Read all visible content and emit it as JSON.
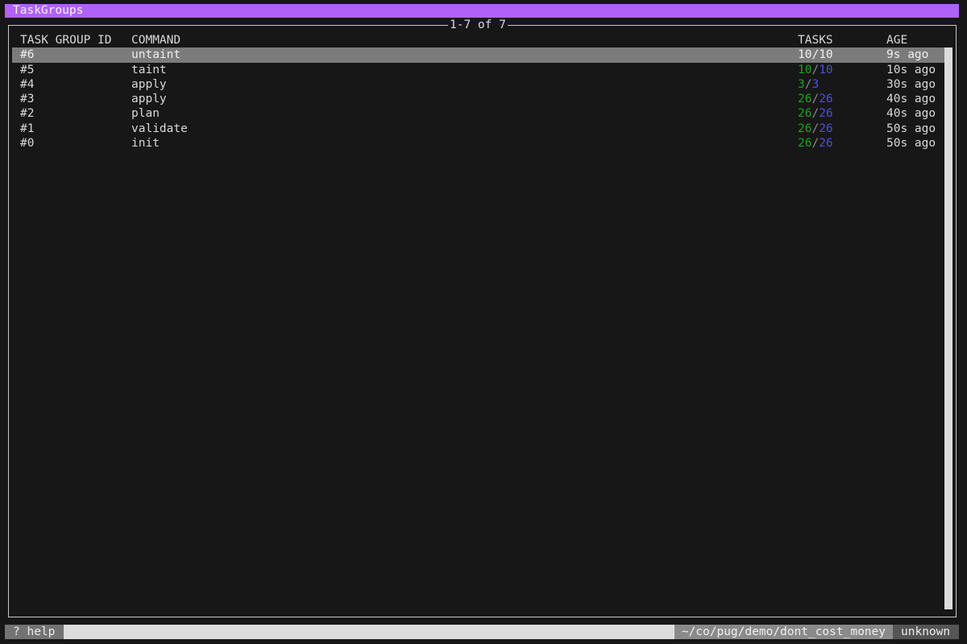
{
  "window": {
    "title": "TaskGroups"
  },
  "pager": {
    "label": "1-7 of 7"
  },
  "table": {
    "columns": {
      "id": "TASK GROUP ID",
      "command": "COMMAND",
      "tasks": "TASKS",
      "age": "AGE"
    },
    "rows": [
      {
        "id": "#6",
        "command": "untaint",
        "tasks_done": "10",
        "tasks_total": "10",
        "age": "9s ago",
        "selected": true
      },
      {
        "id": "#5",
        "command": "taint",
        "tasks_done": "10",
        "tasks_total": "10",
        "age": "10s ago"
      },
      {
        "id": "#4",
        "command": "apply",
        "tasks_done": "3",
        "tasks_total": "3",
        "age": "30s ago"
      },
      {
        "id": "#3",
        "command": "apply",
        "tasks_done": "26",
        "tasks_total": "26",
        "age": "40s ago"
      },
      {
        "id": "#2",
        "command": "plan",
        "tasks_done": "26",
        "tasks_total": "26",
        "age": "40s ago"
      },
      {
        "id": "#1",
        "command": "validate",
        "tasks_done": "26",
        "tasks_total": "26",
        "age": "50s ago"
      },
      {
        "id": "#0",
        "command": "init",
        "tasks_done": "26",
        "tasks_total": "26",
        "age": "50s ago"
      }
    ],
    "separator": "/"
  },
  "statusbar": {
    "help": "? help",
    "path": "~/co/pug/demo/dont_cost_money",
    "workspace": "unknown"
  },
  "colors": {
    "accent": "#b061f7",
    "tasks_done": "#1fa21f",
    "tasks_total": "#4f4fd6",
    "selected_row": "#7b7b7b"
  }
}
